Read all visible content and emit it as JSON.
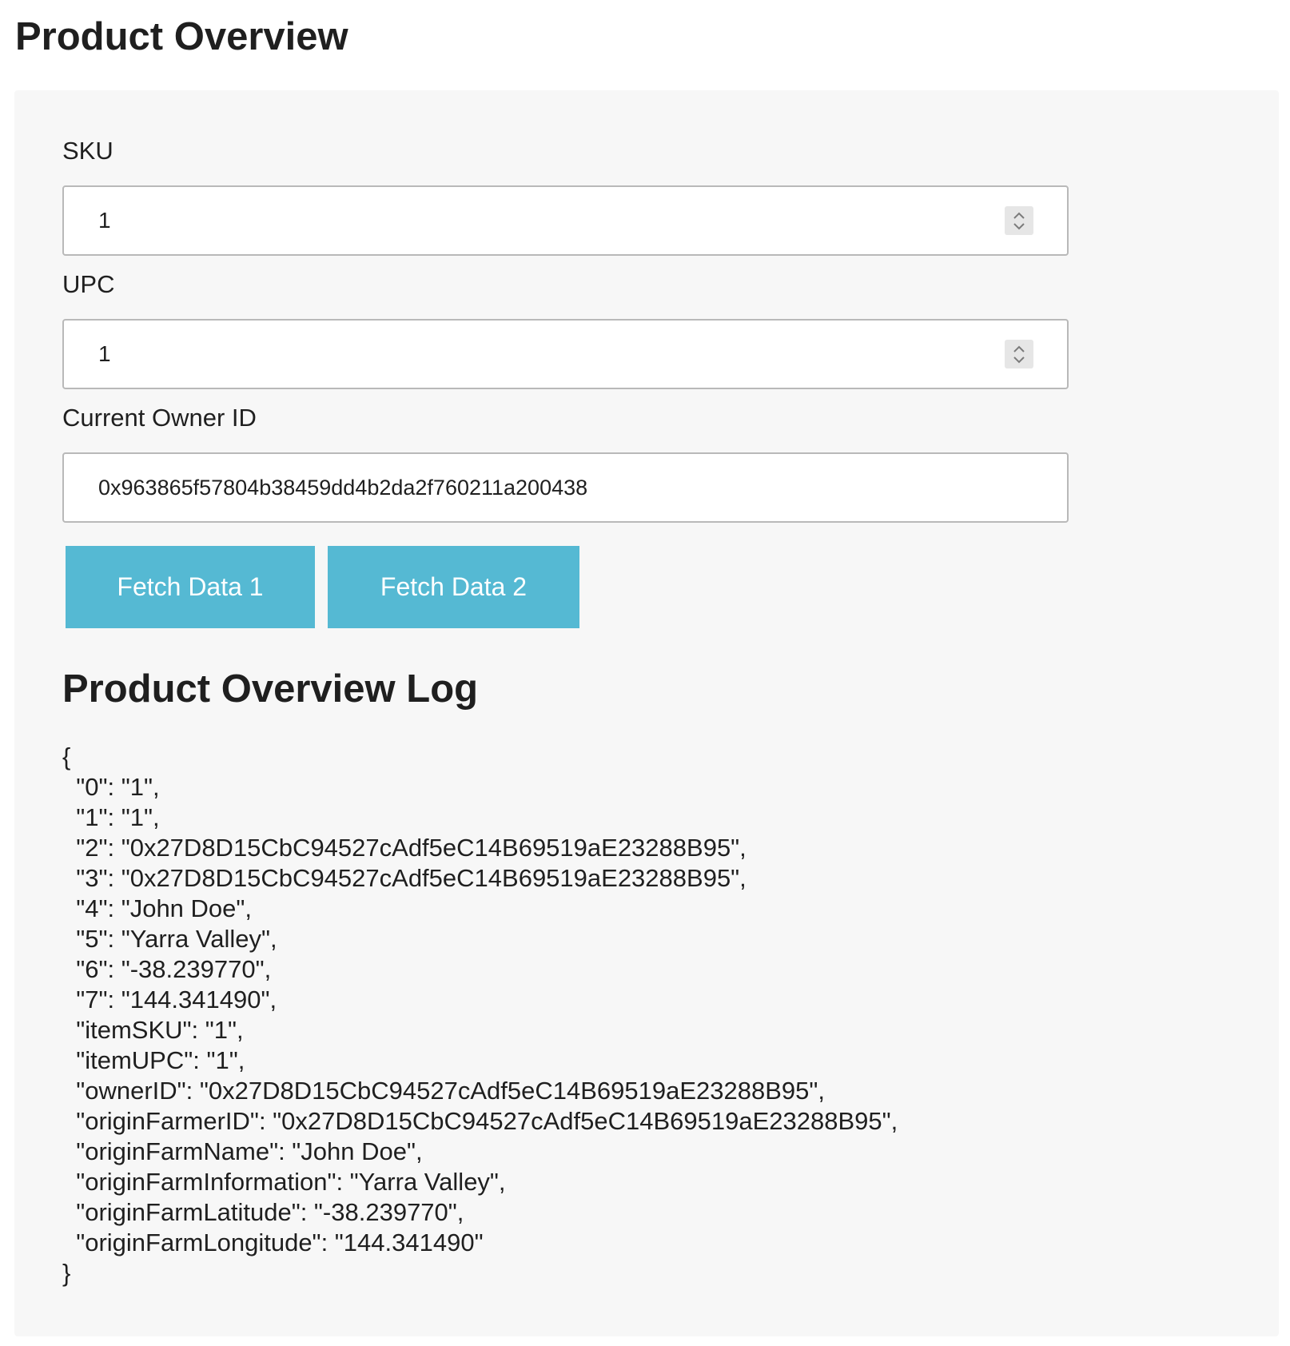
{
  "page": {
    "title": "Product Overview"
  },
  "form": {
    "sku": {
      "label": "SKU",
      "value": "1"
    },
    "upc": {
      "label": "UPC",
      "value": "1"
    },
    "owner": {
      "label": "Current Owner ID",
      "value": "0x963865f57804b38459dd4b2da2f760211a200438"
    },
    "buttons": {
      "fetch1": "Fetch Data 1",
      "fetch2": "Fetch Data 2"
    }
  },
  "log": {
    "title": "Product Overview Log",
    "body": "{\n  \"0\": \"1\",\n  \"1\": \"1\",\n  \"2\": \"0x27D8D15CbC94527cAdf5eC14B69519aE23288B95\",\n  \"3\": \"0x27D8D15CbC94527cAdf5eC14B69519aE23288B95\",\n  \"4\": \"John Doe\",\n  \"5\": \"Yarra Valley\",\n  \"6\": \"-38.239770\",\n  \"7\": \"144.341490\",\n  \"itemSKU\": \"1\",\n  \"itemUPC\": \"1\",\n  \"ownerID\": \"0x27D8D15CbC94527cAdf5eC14B69519aE23288B95\",\n  \"originFarmerID\": \"0x27D8D15CbC94527cAdf5eC14B69519aE23288B95\",\n  \"originFarmName\": \"John Doe\",\n  \"originFarmInformation\": \"Yarra Valley\",\n  \"originFarmLatitude\": \"-38.239770\",\n  \"originFarmLongitude\": \"144.341490\"\n}"
  },
  "colors": {
    "button": "#55b9d3",
    "panel": "#f7f7f7",
    "field_border": "#b9b9b9"
  },
  "icons": {
    "stepper": "chevron-up-down-icon"
  }
}
